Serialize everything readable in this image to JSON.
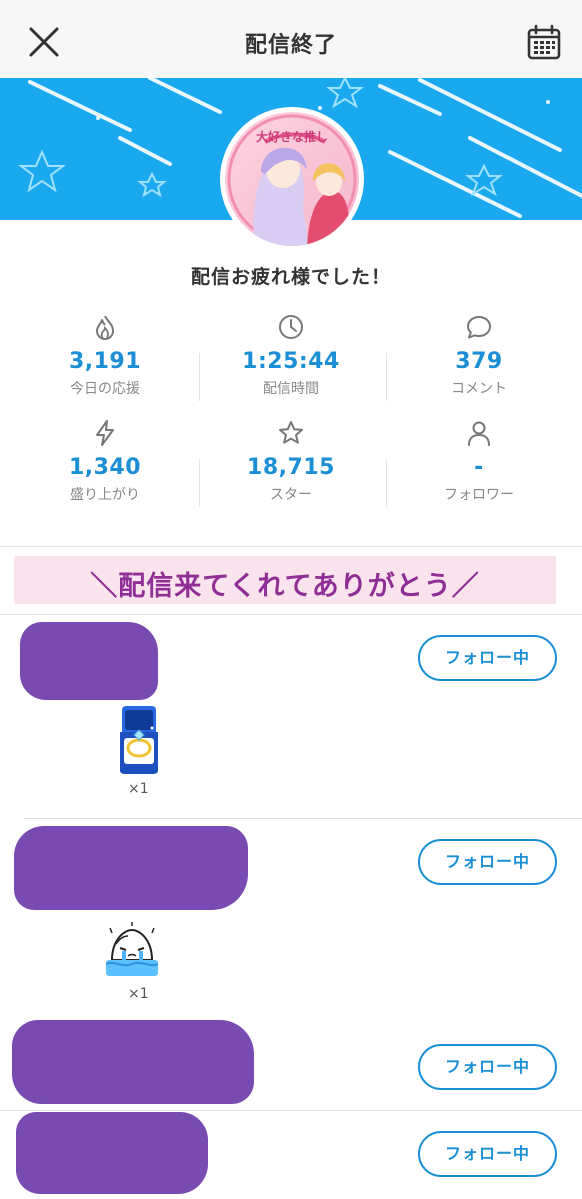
{
  "header": {
    "title": "配信終了",
    "close_icon": "close-icon",
    "calendar_icon": "calendar-icon"
  },
  "banner": {
    "background_color": "#1aa9ef",
    "avatar_text": "大好きな推し"
  },
  "message": "配信お疲れ様でした！",
  "stats": [
    {
      "icon": "flame-icon",
      "value": "3,191",
      "label": "今日の応援"
    },
    {
      "icon": "clock-icon",
      "value": "1:25:44",
      "label": "配信時間"
    },
    {
      "icon": "comment-icon",
      "value": "379",
      "label": "コメント"
    },
    {
      "icon": "lightning-icon",
      "value": "1,340",
      "label": "盛り上がり"
    },
    {
      "icon": "star-icon",
      "value": "18,715",
      "label": "スター"
    },
    {
      "icon": "person-icon",
      "value": "-",
      "label": "フォロワー"
    }
  ],
  "thanks_banner": "＼配信来てくれてありがとう／",
  "supporters": [
    {
      "button": "フォロー中",
      "gift_icon": "ring-box-icon",
      "gift_count": "×1"
    },
    {
      "button": "フォロー中",
      "gift_icon": "crying-character-icon",
      "gift_count": "×1"
    },
    {
      "button": "フォロー中"
    },
    {
      "button": "フォロー中"
    }
  ],
  "colors": {
    "accent": "#1a8fd6",
    "redaction": "#7a4ab3",
    "thanks_banner_bg": "#fbe3ee",
    "thanks_banner_text": "#8f2f95"
  }
}
